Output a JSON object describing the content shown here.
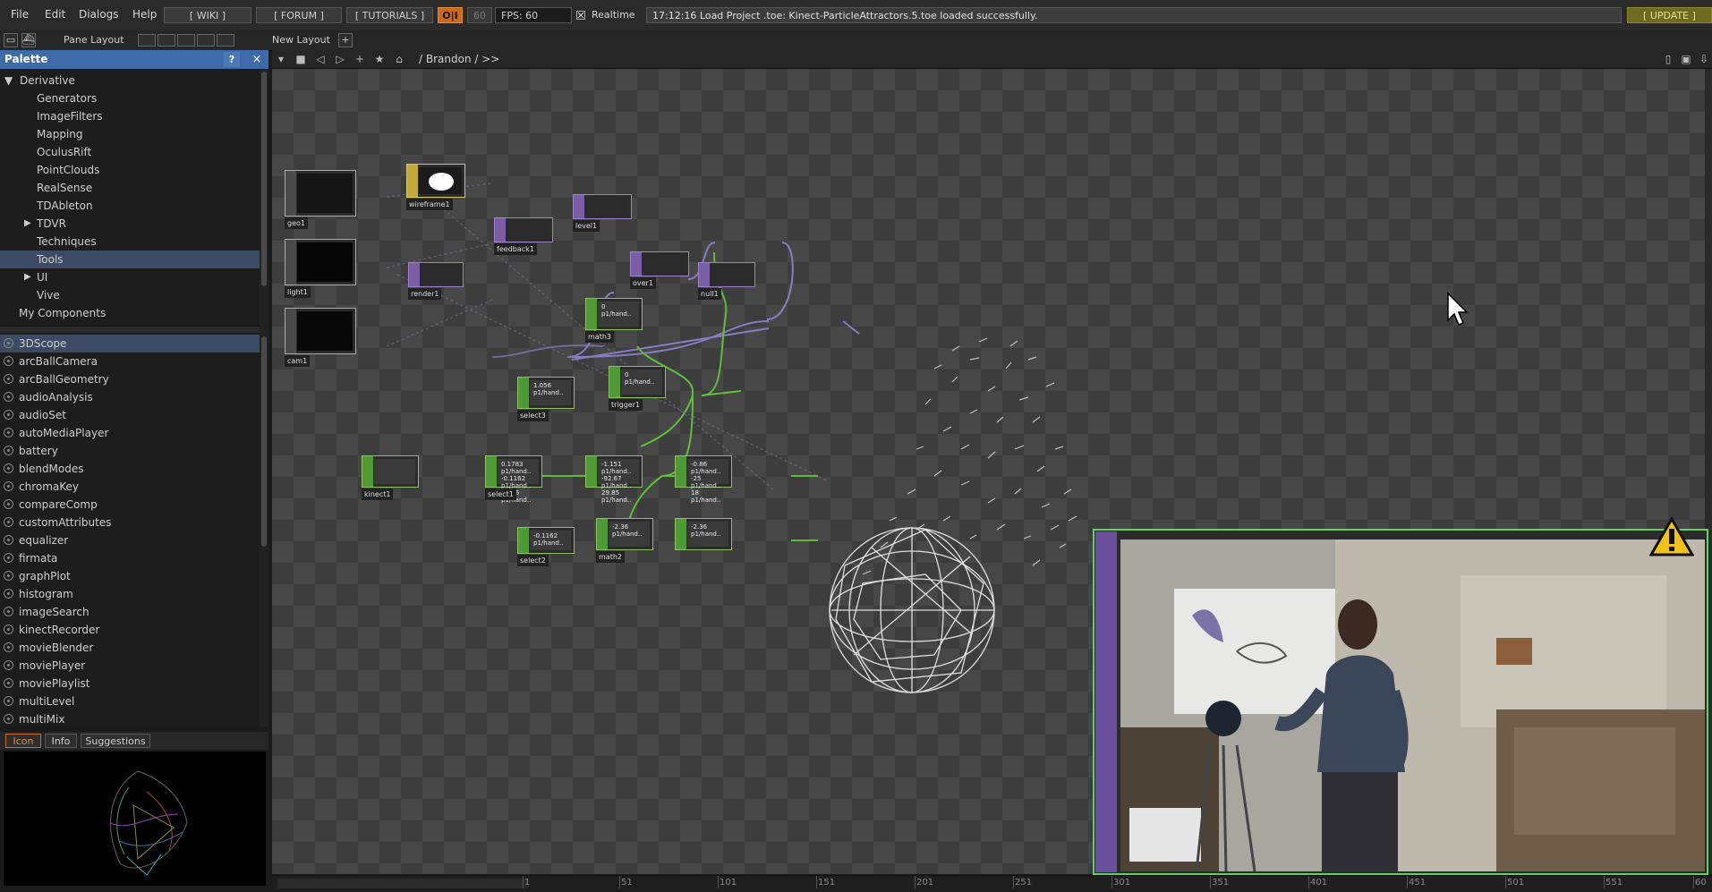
{
  "menubar": {
    "menus": [
      "File",
      "Edit",
      "Dialogs",
      "Help"
    ],
    "buttons": {
      "wiki": "[ WIKI ]",
      "forum": "[ FORUM ]",
      "tutorials": "[ TUTORIALS ]",
      "oi": "O|I",
      "fps_target": "60",
      "fps": "FPS:  60",
      "realtime": "Realtime"
    },
    "status": "17:12:16 Load Project .toe: Kinect-ParticleAttractors.5.toe loaded successfully.",
    "update": "[ UPDATE ]"
  },
  "bar2": {
    "pane_layout": "Pane Layout",
    "new_layout": "New Layout",
    "add": "+"
  },
  "palette": {
    "title": "Palette",
    "help": "?",
    "close": "×",
    "tree": [
      {
        "label": "Derivative",
        "expanded": true,
        "level": 0
      },
      {
        "label": "Generators",
        "level": 1
      },
      {
        "label": "ImageFilters",
        "level": 1
      },
      {
        "label": "Mapping",
        "level": 1
      },
      {
        "label": "OculusRift",
        "level": 1
      },
      {
        "label": "PointClouds",
        "level": 1
      },
      {
        "label": "RealSense",
        "level": 1
      },
      {
        "label": "TDAbleton",
        "level": 1
      },
      {
        "label": "TDVR",
        "collapsed": true,
        "level": 1
      },
      {
        "label": "Techniques",
        "level": 1
      },
      {
        "label": "Tools",
        "level": 1,
        "selected": true
      },
      {
        "label": "UI",
        "collapsed": true,
        "level": 1
      },
      {
        "label": "Vive",
        "level": 1
      },
      {
        "label": "My Components",
        "level": 0
      }
    ],
    "components": [
      "3DScope",
      "arcBallCamera",
      "arcBallGeometry",
      "audioAnalysis",
      "audioSet",
      "autoMediaPlayer",
      "battery",
      "blendModes",
      "chromaKey",
      "compareComp",
      "customAttributes",
      "equalizer",
      "firmata",
      "graphPlot",
      "histogram",
      "imageSearch",
      "kinectRecorder",
      "movieBlender",
      "moviePlayer",
      "moviePlaylist",
      "multiLevel",
      "multiMix"
    ],
    "selected_component": "3DScope",
    "tabs": [
      "Icon",
      "Info",
      "Suggestions"
    ],
    "active_tab": "Icon"
  },
  "editor": {
    "path": "/ Brandon / >>"
  },
  "nodes": {
    "geo1": "geo1",
    "light1": "light1",
    "cam1": "cam1",
    "wireframe1": "wireframe1",
    "render1": "render1",
    "feedback1": "feedback1",
    "level1": "level1",
    "over1": "over1",
    "null1": "null1",
    "math3": "math3",
    "trigger1": "trigger1",
    "select3": "select3",
    "kinect1": "kinect1",
    "select1": "select1",
    "math1": "math1",
    "select2": "select2",
    "math2": "math2"
  },
  "chop_values": {
    "math3": "0  p1/hand..",
    "trigger1": "0  p1/hand..",
    "select3": "1.056  p1/hand..",
    "select1": [
      "0.1783  p1/hand..",
      "-0.1162  p1/hand..",
      "1.056  p1/hand.."
    ],
    "math1": [
      "-1.151  p1/hand..",
      "-92.67  p1/hand..",
      "29.85  p1/hand.."
    ],
    "math_right": [
      "-0.86  p1/hand..",
      "-25  p1/hand..",
      "18  p1/hand.."
    ],
    "select2": "-0.1162  p1/hand..",
    "math2": "-2.36  p1/hand..",
    "limit": "-2.36  p1/hand.."
  },
  "timeline": {
    "ticks": [
      "1",
      "51",
      "101",
      "151",
      "201",
      "251",
      "301",
      "351",
      "401",
      "451",
      "501",
      "551",
      "60"
    ]
  },
  "icons": [
    "triangle-right-icon",
    "triangle-down-icon",
    "warning-icon",
    "cursor-icon",
    "home-icon",
    "star-icon",
    "stop-icon"
  ],
  "colors": {
    "palette_header": "#3f6aa8",
    "top_operator": "#7b5ea8",
    "chop_operator": "#4f9a34",
    "warning": "#f2c21b",
    "camera_border": "#5fd45a",
    "update_bg": "#6d6b1f"
  }
}
